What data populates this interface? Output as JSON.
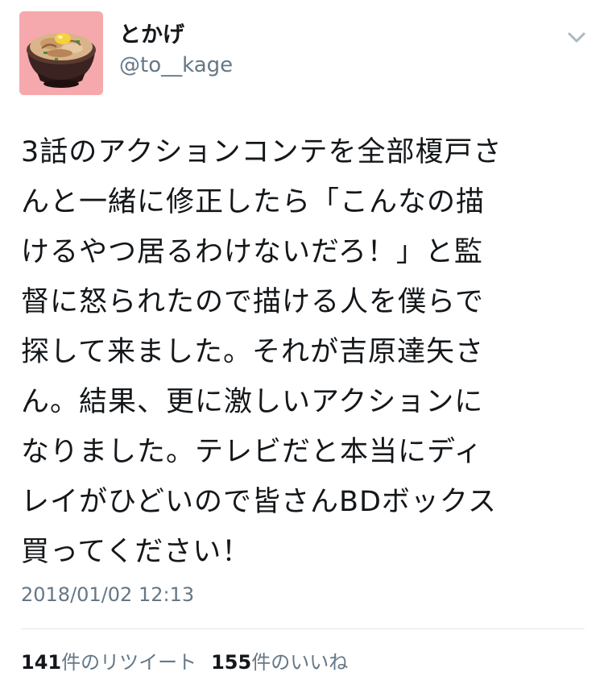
{
  "user": {
    "display_name": "とかげ",
    "handle": "@to__kage",
    "avatar_icon": "food-bowl-avatar-icon"
  },
  "menu": {
    "icon": "chevron-down-icon"
  },
  "tweet": {
    "lines": [
      "3話のアクションコンテを全部榎戸さ",
      "んと一緒に修正したら「こんなの描",
      "けるやつ居るわけないだろ！」と監",
      "督に怒られたので描ける人を僕らで",
      "探して来ました。それが吉原達矢さ",
      "ん。結果、更に激しいアクションに",
      "なりました。テレビだと本当にディ",
      "レイがひどいので皆さんBDボックス",
      "買ってください！"
    ],
    "timestamp": "2018/01/02 12:13"
  },
  "stats": {
    "retweets_count": "141",
    "retweets_label": "件のリツイート",
    "likes_count": "155",
    "likes_label": "件のいいね"
  },
  "colors": {
    "text": "#14171a",
    "secondary": "#657786",
    "divider": "#e1e8ed",
    "avatar_bg": "#f6a9ad"
  }
}
